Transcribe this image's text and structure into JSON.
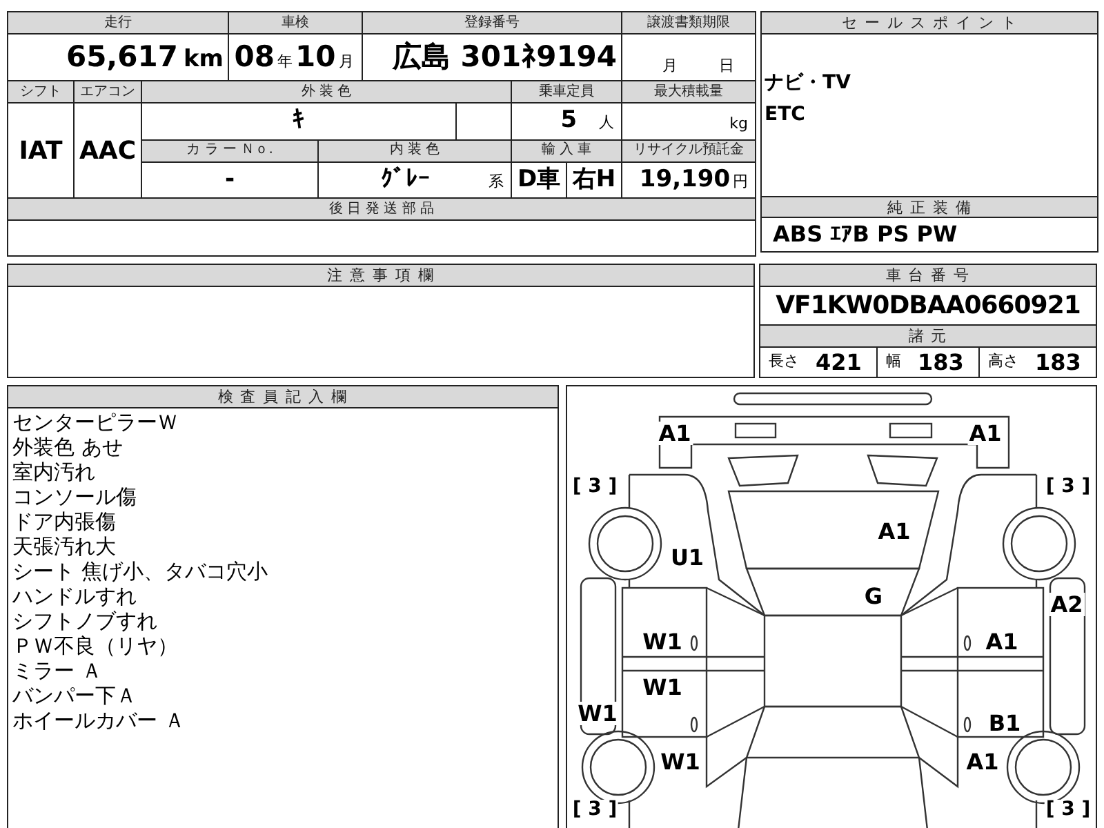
{
  "mileage": {
    "label": "走行",
    "value": "65,617",
    "unit": "km"
  },
  "inspection": {
    "label": "車検",
    "year": "08",
    "year_unit": "年",
    "month": "10",
    "month_unit": "月"
  },
  "registration": {
    "label": "登録番号",
    "value": "広島 301ﾈ9194"
  },
  "transfer_deadline": {
    "label": "譲渡書類期限",
    "month_unit": "月",
    "day_unit": "日"
  },
  "shift": {
    "label": "シフト",
    "value": "IAT"
  },
  "air_conditioner": {
    "label": "エアコン",
    "value": "AAC"
  },
  "exterior_color": {
    "label": "外 装 色",
    "value": "ｷ"
  },
  "capacity": {
    "label": "乗車定員",
    "value": "5",
    "unit": "人"
  },
  "max_load": {
    "label": "最大積載量",
    "unit": "kg"
  },
  "color_no": {
    "label": "カ ラ ー Ｎｏ.",
    "value": "-"
  },
  "interior_color": {
    "label": "内 装 色",
    "value": "ｸﾞﾚｰ",
    "suffix": "系"
  },
  "import": {
    "label": "輸 入 車",
    "dealer": "D車",
    "steering": "右H"
  },
  "recycle_fee": {
    "label": "リサイクル預託金",
    "value": "19,190",
    "unit": "円"
  },
  "later_parts": {
    "label": "後 日 発 送 部 品"
  },
  "sales_points": {
    "label": "セ ー ル ス ポ イ ン ト",
    "lines": [
      "ナビ・TV",
      "ETC"
    ]
  },
  "genuine_equipment": {
    "label": "純 正 装 備",
    "value": "ABS ｴｱB PS PW"
  },
  "notes": {
    "label": "注 意 事 項 欄"
  },
  "chassis_number": {
    "label": "車 台 番 号",
    "value": "VF1KW0DBAA0660921"
  },
  "specs": {
    "label": "諸 元",
    "items": [
      {
        "label": "長さ",
        "value": "421"
      },
      {
        "label": "幅",
        "value": "183"
      },
      {
        "label": "高さ",
        "value": "183"
      }
    ]
  },
  "inspector_notes": {
    "label": "検 査 員 記 入 欄",
    "lines": [
      "センターピラーＷ",
      "外装色 あせ",
      "室内汚れ",
      "コンソール傷",
      "ドア内張傷",
      "天張汚れ大",
      "シート 焦げ小、タバコ穴小",
      "ハンドルすれ",
      "シフトノブすれ",
      "ＰＷ不良（リヤ）",
      "ミラー Ａ",
      "バンパー下Ａ",
      "ホイールカバー Ａ"
    ]
  },
  "damage_map": {
    "marks": [
      {
        "kind": "damage",
        "text": "A1"
      },
      {
        "kind": "damage",
        "text": "A1"
      },
      {
        "kind": "tread",
        "text": "[ 3 ]"
      },
      {
        "kind": "tread",
        "text": "[ 3 ]"
      },
      {
        "kind": "damage",
        "text": "A1"
      },
      {
        "kind": "damage",
        "text": "U1"
      },
      {
        "kind": "damage",
        "text": "G"
      },
      {
        "kind": "damage",
        "text": "A2"
      },
      {
        "kind": "damage",
        "text": "W1"
      },
      {
        "kind": "damage",
        "text": "A1"
      },
      {
        "kind": "damage",
        "text": "W1"
      },
      {
        "kind": "damage",
        "text": "W1"
      },
      {
        "kind": "damage",
        "text": "B1"
      },
      {
        "kind": "damage",
        "text": "W1"
      },
      {
        "kind": "damage",
        "text": "A1"
      },
      {
        "kind": "tread",
        "text": "[ 3 ]"
      },
      {
        "kind": "tread",
        "text": "[ 3 ]"
      }
    ]
  }
}
